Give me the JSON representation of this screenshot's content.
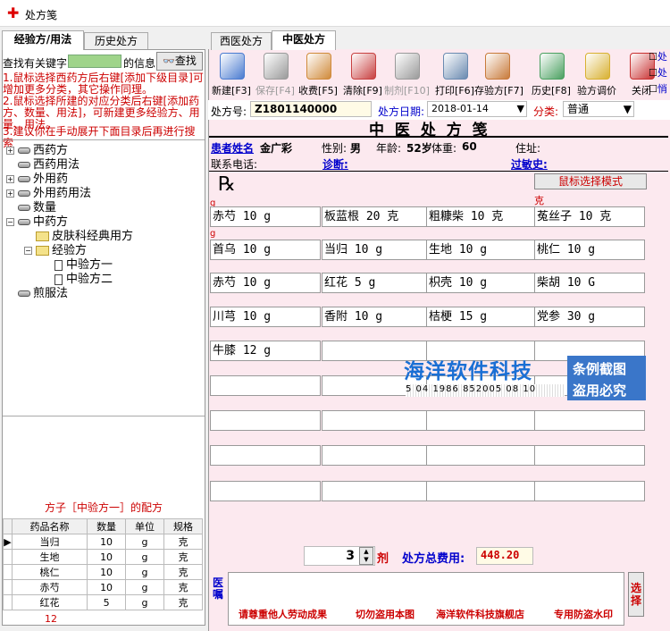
{
  "window": {
    "title": "处方笺"
  },
  "left_tabs": [
    "经验方/用法",
    "历史处方"
  ],
  "search": {
    "prefix": "查找有关键字",
    "suffix": "的信息",
    "button": "查找"
  },
  "notes": [
    "1.鼠标选择西药方后右键[添加下级目录]可增加更多分类，其它操作同理。",
    "2.鼠标选择所建的对应分类后右键[添加药方、数量、用法]，可新建更多经验方、用量、用法。",
    "3.建议你在手动展开下面目录后再进行搜索"
  ],
  "tree": [
    {
      "label": "西药方",
      "icon": "drawer-icon",
      "exp": "+"
    },
    {
      "label": "西药用法",
      "icon": "drawer-icon",
      "exp": ""
    },
    {
      "label": "外用药",
      "icon": "drawer-icon",
      "exp": "+"
    },
    {
      "label": "外用药用法",
      "icon": "drawer-icon",
      "exp": "+"
    },
    {
      "label": "数量",
      "icon": "drawer-icon",
      "exp": ""
    },
    {
      "label": "中药方",
      "icon": "drawer-icon",
      "exp": "−"
    },
    {
      "label": "皮肤科经典用方",
      "icon": "folder-icon",
      "exp": ""
    },
    {
      "label": "经验方",
      "icon": "folder-open-icon",
      "exp": "−"
    },
    {
      "label": "中验方一",
      "icon": "doc-icon",
      "exp": ""
    },
    {
      "label": "中验方二",
      "icon": "doc-icon",
      "exp": ""
    },
    {
      "label": "煎服法",
      "icon": "drawer-icon",
      "exp": ""
    }
  ],
  "sub_caption": "方子［中验方一］的配方",
  "mini_table": {
    "headers": [
      "药品名称",
      "数量",
      "单位",
      "规格"
    ],
    "rows": [
      [
        "当归",
        "10",
        "g",
        "克"
      ],
      [
        "生地",
        "10",
        "g",
        "克"
      ],
      [
        "桃仁",
        "10",
        "g",
        "克"
      ],
      [
        "赤芍",
        "10",
        "g",
        "克"
      ],
      [
        "红花",
        "5",
        "g",
        "克"
      ]
    ],
    "footer": "12"
  },
  "right_tabs": [
    "西医处方",
    "中医处方"
  ],
  "toolbar": [
    {
      "label": "新建[F3]",
      "icon": "new-icon",
      "color": "#4a7bd0",
      "enabled": true
    },
    {
      "label": "保存[F4]",
      "icon": "save-icon",
      "color": "#9a9a9a",
      "enabled": false
    },
    {
      "label": "收费[F5]",
      "icon": "charge-icon",
      "color": "#d08a3a",
      "enabled": true
    },
    {
      "label": "清除[F9]",
      "icon": "clear-icon",
      "color": "#c84040",
      "enabled": true
    },
    {
      "label": "制剂[F10]",
      "icon": "prep-icon",
      "color": "#9a9a9a",
      "enabled": false
    },
    {
      "label": "打印[F6]",
      "icon": "print-icon",
      "color": "#6a8ab0",
      "enabled": true
    },
    {
      "label": "存验方[F7]",
      "icon": "save-recipe-icon",
      "color": "#c87a3a",
      "enabled": true
    },
    {
      "label": "历史[F8]",
      "icon": "history-icon",
      "color": "#4aa060",
      "enabled": true
    },
    {
      "label": "验方调价",
      "icon": "price-icon",
      "color": "#d8b030",
      "enabled": true
    },
    {
      "label": "关闭",
      "icon": "close-icon",
      "color": "#c83030",
      "enabled": true
    }
  ],
  "checkbox_labels": [
    "处",
    "处",
    "悄"
  ],
  "form": {
    "rx_no_label": "处方号:",
    "rx_no": "Z1801140000",
    "date_label": "处方日期:",
    "date": "2018-01-14",
    "category_label": "分类:",
    "category": "普通",
    "heading": "中 医 处 方 笺"
  },
  "patient": {
    "name_label": "患者姓名",
    "name": "金广彩",
    "sex_label": "性别:",
    "sex": "男",
    "age_label": "年龄:",
    "age": "52岁",
    "weight_label": "体重:",
    "weight": "60",
    "addr_label": "住址:",
    "phone_label": "联系电话:",
    "diag_label": "诊断:",
    "allergy_label": "过敏史:"
  },
  "mouse_mode_button": "鼠标选择模式",
  "unit_marks": [
    "g",
    "克",
    "g"
  ],
  "herbs": [
    [
      "赤芍 10 g",
      "板蓝根 20 克",
      "粗糠柴 10 克",
      "菟丝子 10 克"
    ],
    [
      "首乌 10 g",
      "当归 10 g",
      "生地 10 g",
      "桃仁 10 g"
    ],
    [
      "赤芍 10 g",
      "红花 5 g",
      "枳壳 10 g",
      "柴胡 10 G"
    ],
    [
      "川芎 10 g",
      "香附 10 g",
      "桔梗 15 g",
      "党参 30 g"
    ],
    [
      "牛膝 12 g",
      "",
      "",
      ""
    ],
    [
      "",
      "",
      "",
      ""
    ],
    [
      "",
      "",
      "",
      ""
    ],
    [
      "",
      "",
      "",
      ""
    ],
    [
      "",
      "",
      "",
      ""
    ]
  ],
  "dose": {
    "count": "3",
    "unit": "剂",
    "total_label": "处方总费用:",
    "total": "448.20"
  },
  "doctor_label": "医嘱",
  "select_button": "选择",
  "watermark": {
    "title": "海洋软件科技",
    "digits": "5 04 1986 852005 08 10",
    "side1": "条例截图",
    "side2": "盗用必究"
  },
  "footer": [
    "请尊重他人劳动成果",
    "切勿盗用本图",
    "海洋软件科技旗舰店",
    "专用防盗水印"
  ],
  "colors": {
    "accent_red": "#cc0000",
    "link_blue": "#0000cc",
    "panel_pink": "#fce9ef",
    "input_green": "#9fd48a"
  }
}
